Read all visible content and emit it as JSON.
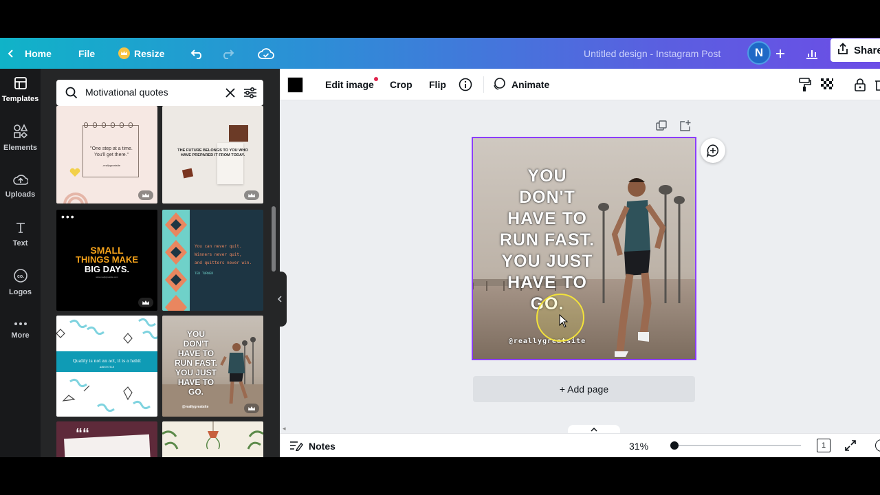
{
  "topbar": {
    "home": "Home",
    "file": "File",
    "resize": "Resize",
    "doc_title": "Untitled design - Instagram Post",
    "avatar_initial": "N",
    "share": "Share"
  },
  "rail": {
    "items": [
      {
        "label": "Templates",
        "icon": "templates-icon"
      },
      {
        "label": "Elements",
        "icon": "elements-icon"
      },
      {
        "label": "Uploads",
        "icon": "upload-cloud-icon"
      },
      {
        "label": "Text",
        "icon": "text-icon"
      },
      {
        "label": "Logos",
        "icon": "logo-icon"
      },
      {
        "label": "More",
        "icon": "more-dots-icon"
      }
    ]
  },
  "search": {
    "value": "Motivational quotes"
  },
  "templates": [
    {
      "id": "t1",
      "text_a": "\"One step at a time.",
      "text_b": "You'll get there.\"",
      "text_c": "-reallygreatsite"
    },
    {
      "id": "t2",
      "text_a": "THE FUTURE BELONGS TO YOU WHO",
      "text_b": "HAVE PREPARED IT FROM TODAY."
    },
    {
      "id": "t3",
      "text_a": "SMALL",
      "text_b": "THINGS MAKE",
      "text_c": "BIG DAYS.",
      "text_d": "www.reallygreatsite.com"
    },
    {
      "id": "t4",
      "text_a": "You can never quit.",
      "text_b": "Winners never quit,",
      "text_c": "and quitters never win.",
      "text_d": "TED TURNER"
    },
    {
      "id": "t5",
      "text_a": "Quality is not an act, it is a habit",
      "text_b": "ARISTOTLE"
    },
    {
      "id": "t6",
      "lines": [
        "YOU",
        "DON'T",
        "HAVE TO",
        "RUN FAST.",
        "YOU JUST",
        "HAVE TO",
        "GO."
      ],
      "handle": "@reallygreatsite"
    },
    {
      "id": "t7",
      "quote_mark": "““"
    },
    {
      "id": "t8"
    }
  ],
  "toolbar": {
    "edit_image": "Edit image",
    "crop": "Crop",
    "flip": "Flip",
    "animate": "Animate",
    "fill_color": "#000000"
  },
  "design": {
    "lines": [
      "YOU",
      "DON'T",
      "HAVE TO",
      "RUN FAST.",
      "YOU JUST",
      "HAVE TO",
      "GO."
    ],
    "handle": "@reallygreatsite"
  },
  "canvas": {
    "add_page": "+ Add page"
  },
  "bottombar": {
    "notes": "Notes",
    "zoom": "31%",
    "page_count": "1"
  },
  "colors": {
    "accent": "#8b3dff",
    "rail_bg": "#18191b",
    "panel_bg": "#252627"
  }
}
